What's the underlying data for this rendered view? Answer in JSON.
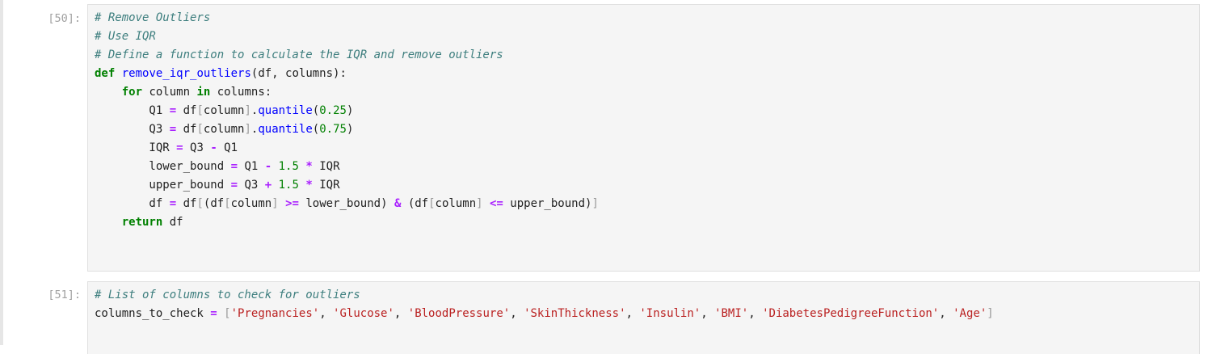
{
  "cells": [
    {
      "prompt": "[50]:",
      "lines": [
        [
          {
            "t": "c",
            "v": "# Remove Outliers"
          }
        ],
        [
          {
            "t": "c",
            "v": "# Use IQR"
          }
        ],
        [
          {
            "t": "c",
            "v": "# Define a function to calculate the IQR and remove outliers"
          }
        ],
        [
          {
            "t": "k",
            "v": "def"
          },
          {
            "t": "pl",
            "v": " "
          },
          {
            "t": "f",
            "v": "remove_iqr_outliers"
          },
          {
            "t": "pl",
            "v": "(df, columns):"
          }
        ],
        [
          {
            "t": "pl",
            "v": "    "
          },
          {
            "t": "k",
            "v": "for"
          },
          {
            "t": "pl",
            "v": " column "
          },
          {
            "t": "k",
            "v": "in"
          },
          {
            "t": "pl",
            "v": " columns:"
          }
        ],
        [
          {
            "t": "pl",
            "v": "        Q1 "
          },
          {
            "t": "o",
            "v": "="
          },
          {
            "t": "pl",
            "v": " df"
          },
          {
            "t": "p",
            "v": "["
          },
          {
            "t": "pl",
            "v": "column"
          },
          {
            "t": "p",
            "v": "]"
          },
          {
            "t": "pl",
            "v": "."
          },
          {
            "t": "f",
            "v": "quantile"
          },
          {
            "t": "pl",
            "v": "("
          },
          {
            "t": "m",
            "v": "0.25"
          },
          {
            "t": "pl",
            "v": ")"
          }
        ],
        [
          {
            "t": "pl",
            "v": "        Q3 "
          },
          {
            "t": "o",
            "v": "="
          },
          {
            "t": "pl",
            "v": " df"
          },
          {
            "t": "p",
            "v": "["
          },
          {
            "t": "pl",
            "v": "column"
          },
          {
            "t": "p",
            "v": "]"
          },
          {
            "t": "pl",
            "v": "."
          },
          {
            "t": "f",
            "v": "quantile"
          },
          {
            "t": "pl",
            "v": "("
          },
          {
            "t": "m",
            "v": "0.75"
          },
          {
            "t": "pl",
            "v": ")"
          }
        ],
        [
          {
            "t": "pl",
            "v": "        IQR "
          },
          {
            "t": "o",
            "v": "="
          },
          {
            "t": "pl",
            "v": " Q3 "
          },
          {
            "t": "o",
            "v": "-"
          },
          {
            "t": "pl",
            "v": " Q1"
          }
        ],
        [
          {
            "t": "pl",
            "v": "        lower_bound "
          },
          {
            "t": "o",
            "v": "="
          },
          {
            "t": "pl",
            "v": " Q1 "
          },
          {
            "t": "o",
            "v": "-"
          },
          {
            "t": "pl",
            "v": " "
          },
          {
            "t": "m",
            "v": "1.5"
          },
          {
            "t": "pl",
            "v": " "
          },
          {
            "t": "o",
            "v": "*"
          },
          {
            "t": "pl",
            "v": " IQR"
          }
        ],
        [
          {
            "t": "pl",
            "v": "        upper_bound "
          },
          {
            "t": "o",
            "v": "="
          },
          {
            "t": "pl",
            "v": " Q3 "
          },
          {
            "t": "o",
            "v": "+"
          },
          {
            "t": "pl",
            "v": " "
          },
          {
            "t": "m",
            "v": "1.5"
          },
          {
            "t": "pl",
            "v": " "
          },
          {
            "t": "o",
            "v": "*"
          },
          {
            "t": "pl",
            "v": " IQR"
          }
        ],
        [
          {
            "t": "pl",
            "v": "        df "
          },
          {
            "t": "o",
            "v": "="
          },
          {
            "t": "pl",
            "v": " df"
          },
          {
            "t": "p",
            "v": "["
          },
          {
            "t": "pl",
            "v": "(df"
          },
          {
            "t": "p",
            "v": "["
          },
          {
            "t": "pl",
            "v": "column"
          },
          {
            "t": "p",
            "v": "]"
          },
          {
            "t": "pl",
            "v": " "
          },
          {
            "t": "o",
            "v": ">="
          },
          {
            "t": "pl",
            "v": " lower_bound) "
          },
          {
            "t": "o",
            "v": "&"
          },
          {
            "t": "pl",
            "v": " (df"
          },
          {
            "t": "p",
            "v": "["
          },
          {
            "t": "pl",
            "v": "column"
          },
          {
            "t": "p",
            "v": "]"
          },
          {
            "t": "pl",
            "v": " "
          },
          {
            "t": "o",
            "v": "<="
          },
          {
            "t": "pl",
            "v": " upper_bound)"
          },
          {
            "t": "p",
            "v": "]"
          }
        ],
        [
          {
            "t": "pl",
            "v": "    "
          },
          {
            "t": "k",
            "v": "return"
          },
          {
            "t": "pl",
            "v": " df"
          }
        ]
      ]
    },
    {
      "prompt": "[51]:",
      "lines": [
        [
          {
            "t": "c",
            "v": "# List of columns to check for outliers"
          }
        ],
        [
          {
            "t": "pl",
            "v": "columns_to_check "
          },
          {
            "t": "o",
            "v": "="
          },
          {
            "t": "pl",
            "v": " "
          },
          {
            "t": "p",
            "v": "["
          },
          {
            "t": "s",
            "v": "'Pregnancies'"
          },
          {
            "t": "pl",
            "v": ", "
          },
          {
            "t": "s",
            "v": "'Glucose'"
          },
          {
            "t": "pl",
            "v": ", "
          },
          {
            "t": "s",
            "v": "'BloodPressure'"
          },
          {
            "t": "pl",
            "v": ", "
          },
          {
            "t": "s",
            "v": "'SkinThickness'"
          },
          {
            "t": "pl",
            "v": ", "
          },
          {
            "t": "s",
            "v": "'Insulin'"
          },
          {
            "t": "pl",
            "v": ", "
          },
          {
            "t": "s",
            "v": "'BMI'"
          },
          {
            "t": "pl",
            "v": ", "
          },
          {
            "t": "s",
            "v": "'DiabetesPedigreeFunction'"
          },
          {
            "t": "pl",
            "v": ", "
          },
          {
            "t": "s",
            "v": "'Age'"
          },
          {
            "t": "p",
            "v": "]"
          }
        ]
      ]
    }
  ]
}
